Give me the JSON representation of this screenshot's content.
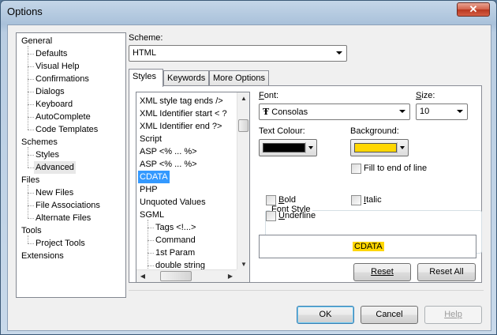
{
  "window": {
    "title": "Options",
    "close_glyph": "✕"
  },
  "tree": {
    "items": [
      {
        "label": "General",
        "level": 0
      },
      {
        "label": "Defaults",
        "level": 1
      },
      {
        "label": "Visual Help",
        "level": 1
      },
      {
        "label": "Confirmations",
        "level": 1
      },
      {
        "label": "Dialogs",
        "level": 1
      },
      {
        "label": "Keyboard",
        "level": 1
      },
      {
        "label": "AutoComplete",
        "level": 1
      },
      {
        "label": "Code Templates",
        "level": 1
      },
      {
        "label": "Schemes",
        "level": 0
      },
      {
        "label": "Styles",
        "level": 1
      },
      {
        "label": "Advanced",
        "level": 1,
        "selected": true
      },
      {
        "label": "Files",
        "level": 0
      },
      {
        "label": "New Files",
        "level": 1
      },
      {
        "label": "File Associations",
        "level": 1
      },
      {
        "label": "Alternate Files",
        "level": 1
      },
      {
        "label": "Tools",
        "level": 0
      },
      {
        "label": "Project Tools",
        "level": 1
      },
      {
        "label": "Extensions",
        "level": 0
      }
    ]
  },
  "scheme": {
    "label": "Scheme:",
    "value": "HTML"
  },
  "tabs": [
    {
      "label": "Styles",
      "active": true
    },
    {
      "label": "Keywords",
      "active": false
    },
    {
      "label": "More Options",
      "active": false
    }
  ],
  "styles_list": {
    "items": [
      {
        "label": "XML style tag ends />",
        "indent": 0
      },
      {
        "label": "XML Identifier start < ?",
        "indent": 0
      },
      {
        "label": "XML Identifier end ?>",
        "indent": 0
      },
      {
        "label": "Script",
        "indent": 0
      },
      {
        "label": "ASP <% ... %>",
        "indent": 0
      },
      {
        "label": "ASP <% ... %>",
        "indent": 0
      },
      {
        "label": "CDATA",
        "indent": 0,
        "selected": true
      },
      {
        "label": "PHP",
        "indent": 0
      },
      {
        "label": "Unquoted Values",
        "indent": 0
      },
      {
        "label": "SGML",
        "indent": 0
      },
      {
        "label": "Tags <!...>",
        "indent": 1
      },
      {
        "label": "Command",
        "indent": 1
      },
      {
        "label": "1st Param",
        "indent": 1
      },
      {
        "label": "double string",
        "indent": 1
      }
    ]
  },
  "font": {
    "label": "Font:",
    "value": "Consolas",
    "icon": "truetype-font-icon",
    "icon_glyph": "Ŧ"
  },
  "size": {
    "label": "Size:",
    "value": "10"
  },
  "text_colour": {
    "label": "Text Colour:",
    "color": "#000000"
  },
  "background": {
    "label": "Background:",
    "color": "#ffd700"
  },
  "fill_to_end": {
    "label": "Fill to end of line",
    "checked": false
  },
  "font_style": {
    "title": "Font Style",
    "bold": {
      "label": "Bold",
      "checked": false
    },
    "italic": {
      "label": "Italic",
      "checked": false
    },
    "underline": {
      "label": "Underline",
      "checked": false
    }
  },
  "preview": {
    "text": "CDATA",
    "highlight": "#ffd700"
  },
  "buttons": {
    "reset": "Reset",
    "reset_all": "Reset All",
    "ok": "OK",
    "cancel": "Cancel",
    "help": "Help"
  }
}
